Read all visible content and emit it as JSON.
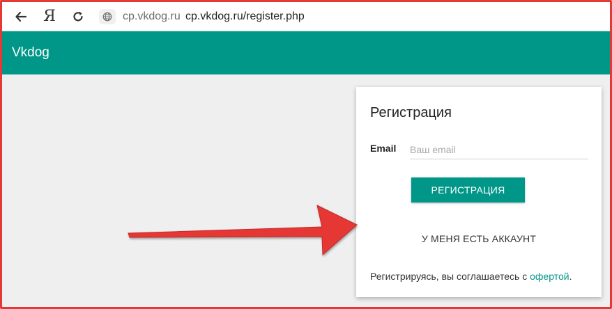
{
  "browser": {
    "back_icon": "arrow-left-icon",
    "yandex_logo": "Я",
    "reload_icon": "reload-icon",
    "site_icon": "globe-icon",
    "domain": "cp.vkdog.ru",
    "url": "cp.vkdog.ru/register.php"
  },
  "app": {
    "brand": "Vkdog",
    "header_color": "#009688"
  },
  "register_card": {
    "title": "Регистрация",
    "email_label": "Email",
    "email_placeholder": "Ваш email",
    "email_value": "",
    "submit_label": "РЕГИСТРАЦИЯ",
    "have_account_label": "У МЕНЯ ЕСТЬ АККАУНТ",
    "agree_text": "Регистрируясь, вы соглашаетесь с ",
    "offer_link": "офертой",
    "agree_end": "."
  },
  "colors": {
    "accent": "#009688",
    "annotation": "#e53935",
    "page_bg": "#efefef"
  }
}
